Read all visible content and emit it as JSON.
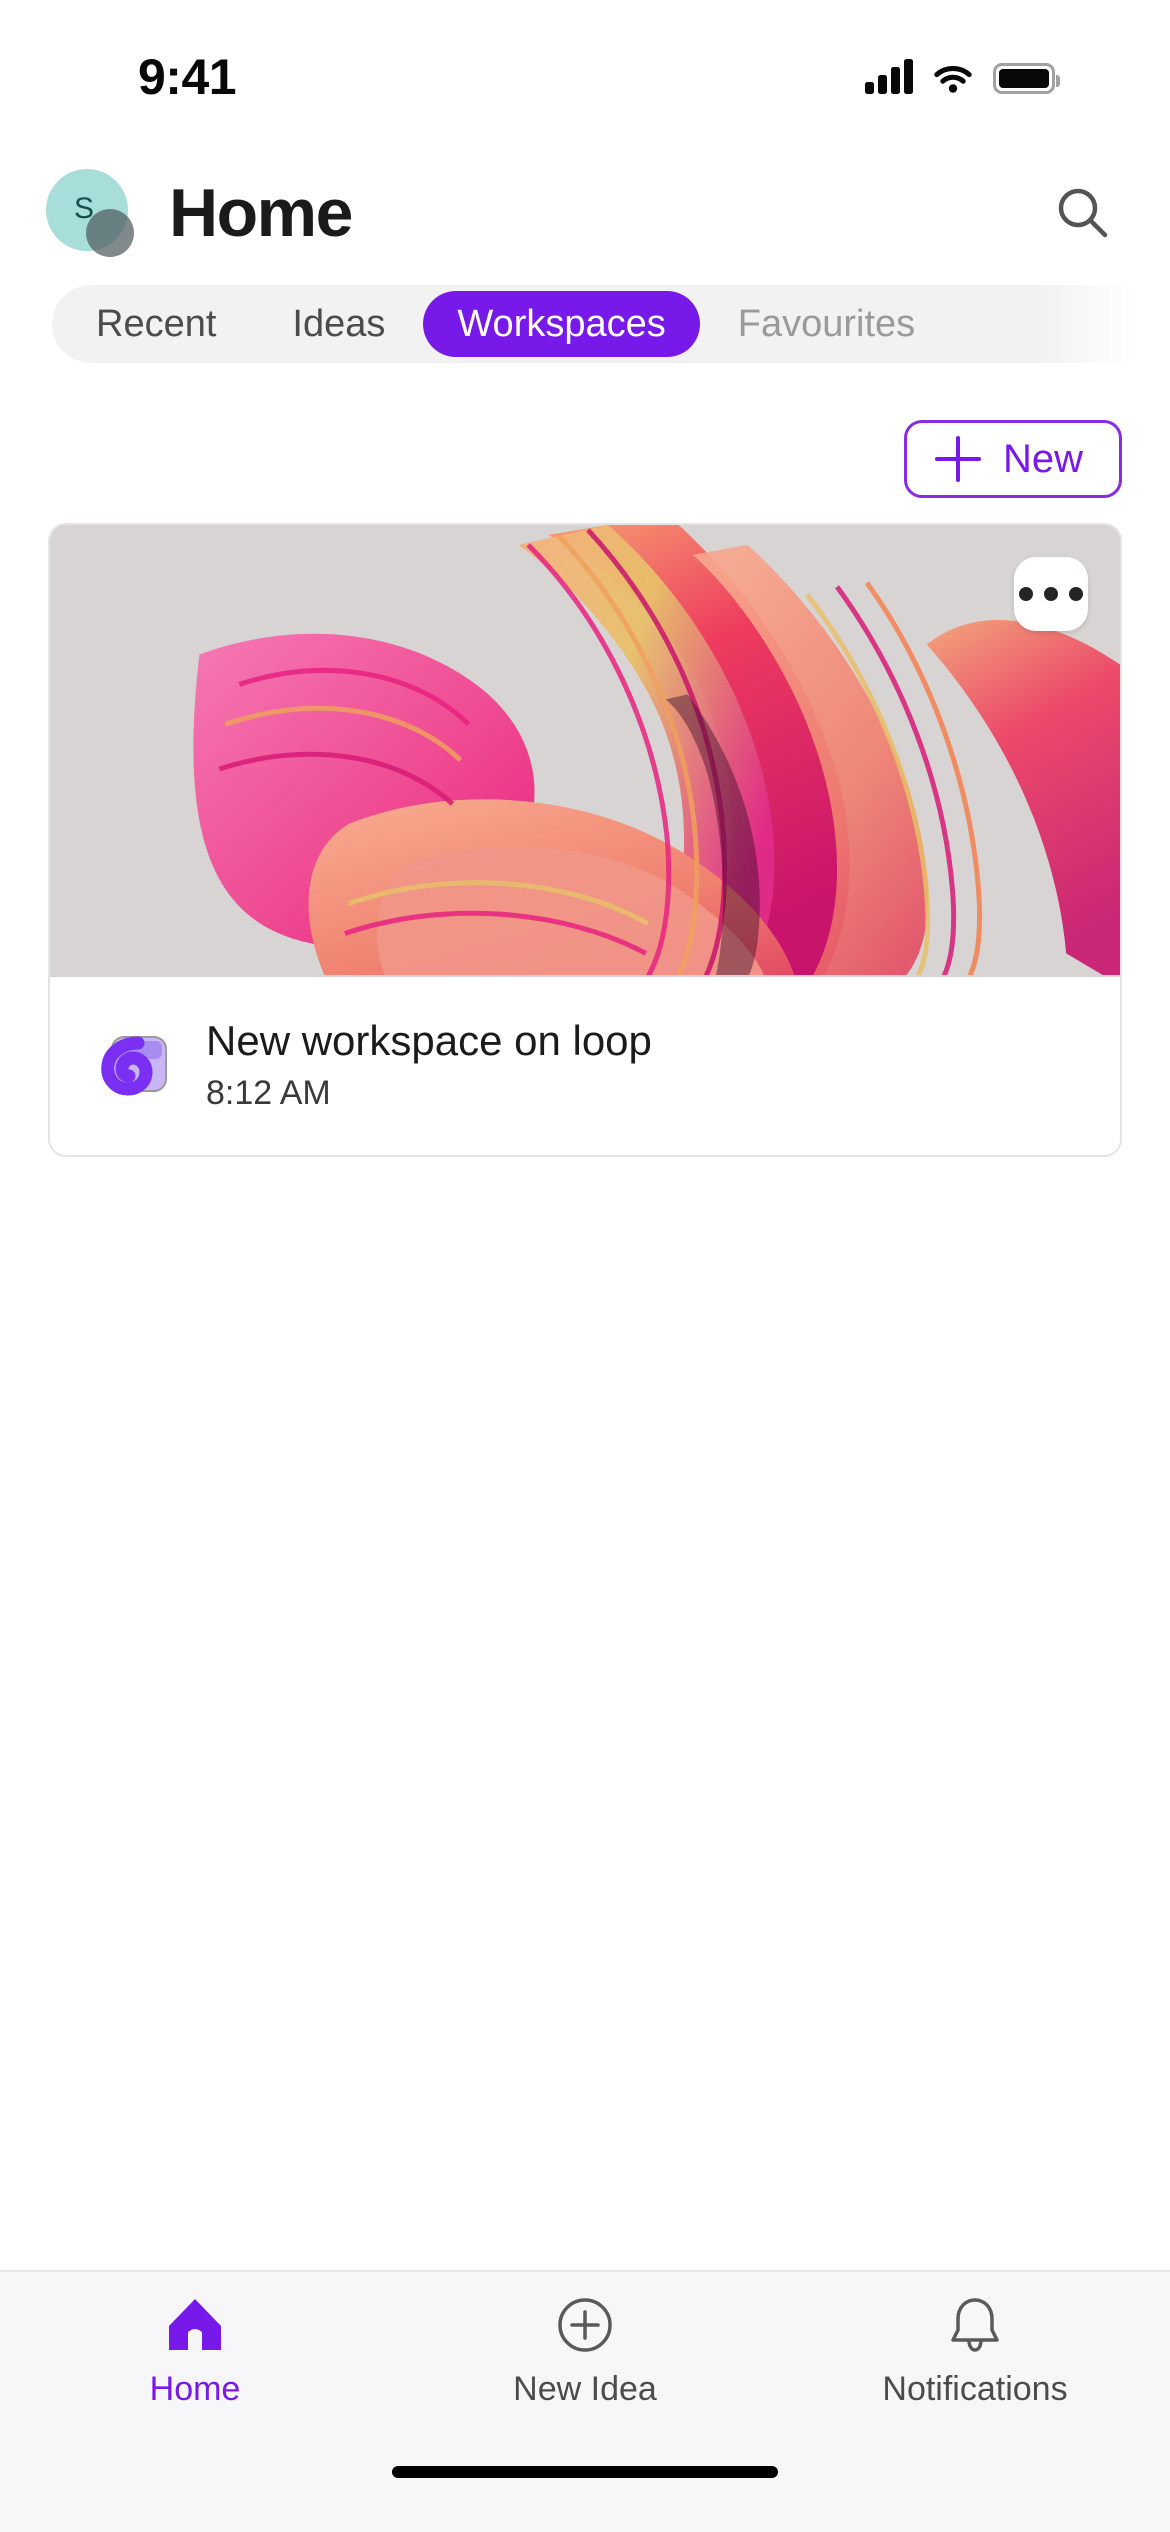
{
  "status_bar": {
    "time": "9:41",
    "icons": [
      "cellular-signal-icon",
      "wifi-icon",
      "battery-icon"
    ]
  },
  "header": {
    "avatar": {
      "initial": "S",
      "name": "avatar",
      "color": "#A8DED9",
      "presence_color": "#505C5F"
    },
    "title": "Home",
    "search_icon": "search-icon"
  },
  "tabs": {
    "items": [
      {
        "label": "Recent",
        "active": false
      },
      {
        "label": "Ideas",
        "active": false
      },
      {
        "label": "Workspaces",
        "active": true
      },
      {
        "label": "Favourites",
        "active": false
      }
    ],
    "active_color": "#7719E8",
    "track_color": "#F2F2F2"
  },
  "actions": {
    "new_label": "New",
    "new_icon": "plus-icon",
    "accent_color": "#7719E8"
  },
  "workspace_card": {
    "more_icon": "more-options-icon",
    "app_icon": "microsoft-loop-icon",
    "title": "New workspace on loop",
    "timestamp": "8:12 AM",
    "art_background": "#D8D4D4",
    "art_colors": [
      "#F35BA0",
      "#E8227F",
      "#F59A6A",
      "#EE3B5E",
      "#E8C06A",
      "#D81B77",
      "#F07F93"
    ]
  },
  "bottom_nav": {
    "items": [
      {
        "label": "Home",
        "icon": "home-icon",
        "active": true
      },
      {
        "label": "New Idea",
        "icon": "plus-circle-icon",
        "active": false
      },
      {
        "label": "Notifications",
        "icon": "bell-icon",
        "active": false
      }
    ],
    "active_color": "#7719E8",
    "inactive_color": "#4C4C4C"
  }
}
